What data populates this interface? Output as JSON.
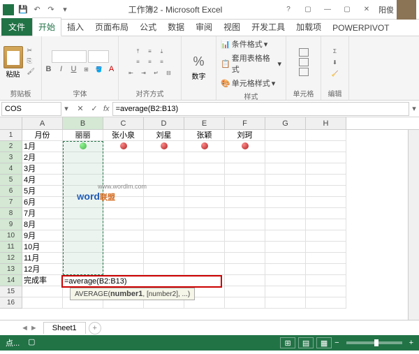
{
  "title": "工作簿2 - Microsoft Excel",
  "user_name": "阳俊",
  "tabs": {
    "file": "文件",
    "home": "开始",
    "insert": "插入",
    "layout": "页面布局",
    "formulas": "公式",
    "data": "数据",
    "review": "审阅",
    "view": "视图",
    "dev": "开发工具",
    "addins": "加载项",
    "powerpivot": "POWERPIVOT"
  },
  "ribbon": {
    "clipboard": {
      "label": "剪贴板",
      "paste": "粘贴"
    },
    "font": {
      "label": "字体"
    },
    "align": {
      "label": "对齐方式"
    },
    "number": {
      "label": "数字",
      "percent": "%"
    },
    "styles": {
      "label": "样式",
      "cond": "条件格式",
      "table": "套用表格格式",
      "cell": "单元格样式"
    },
    "cells": {
      "label": "单元格"
    },
    "editing": {
      "label": "编辑"
    }
  },
  "namebox": "COS",
  "formula": "=average(B2:B13)",
  "columns": [
    "A",
    "B",
    "C",
    "D",
    "E",
    "F",
    "G",
    "H"
  ],
  "rows": [
    "1",
    "2",
    "3",
    "4",
    "5",
    "6",
    "7",
    "8",
    "9",
    "10",
    "11",
    "12",
    "13",
    "14",
    "15",
    "16"
  ],
  "headers": {
    "A": "月份",
    "B": "丽丽",
    "C": "张小泉",
    "D": "刘星",
    "E": "张颖",
    "F": "刘珂"
  },
  "colA": [
    "1月",
    "2月",
    "3月",
    "4月",
    "5月",
    "6月",
    "7月",
    "8月",
    "9月",
    "10月",
    "11月",
    "12月",
    "完成率"
  ],
  "dots": {
    "B": "g",
    "C": "r",
    "D": "r",
    "E": "r",
    "F": "r"
  },
  "edit_cell": {
    "text": "=average(B2:B13)",
    "tooltip": "AVERAGE(number1, [number2], ...)",
    "tooltip_bold": "number1"
  },
  "watermark": {
    "w": "W",
    "ord": "ord",
    "lm": "联盟",
    "url": "www.wordlm.com"
  },
  "sheet": {
    "name": "Sheet1"
  },
  "status": {
    "mode": "点...",
    "rec": "..."
  },
  "zoom": "100%",
  "chart_data": {
    "type": "table",
    "columns": [
      "月份",
      "丽丽",
      "张小泉",
      "刘星",
      "张颖",
      "刘珂"
    ],
    "rows": [
      "1月",
      "2月",
      "3月",
      "4月",
      "5月",
      "6月",
      "7月",
      "8月",
      "9月",
      "10月",
      "11月",
      "12月",
      "完成率"
    ],
    "note": "Row 2 shows status indicators: 丽丽=green, others=red. Cell B14 contains formula =average(B2:B13). Data cells B2:F13 values not visible."
  }
}
